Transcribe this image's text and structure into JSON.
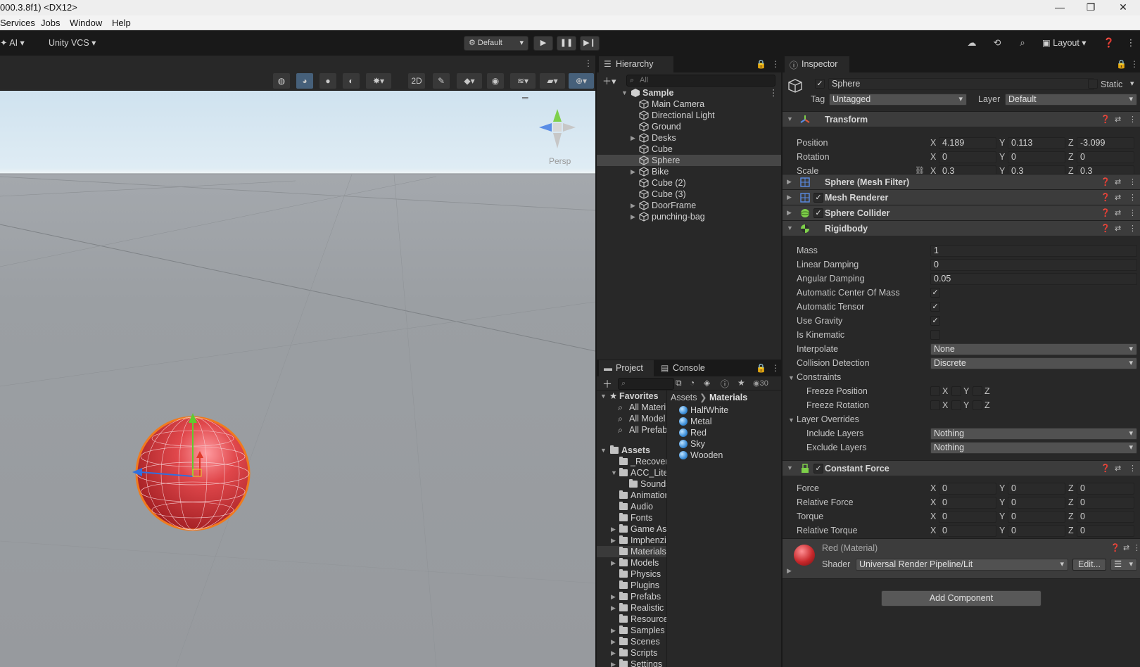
{
  "window": {
    "title": "000.3.8f1) <DX12>",
    "controls": {
      "minimize": "—",
      "maximize": "❐",
      "close": "✕"
    }
  },
  "menu": [
    "Services",
    "Jobs",
    "Window",
    "Help"
  ],
  "toolbar": {
    "ai_label": "AI",
    "vcs_label": "Unity VCS",
    "build_profile": "Default",
    "layout_label": "Layout"
  },
  "scene": {
    "persp_label": "Persp"
  },
  "hierarchy": {
    "tab": "Hierarchy",
    "search_placeholder": "All",
    "scene_name": "Sample",
    "items": [
      {
        "label": "Main Camera",
        "expandable": false
      },
      {
        "label": "Directional Light",
        "expandable": false
      },
      {
        "label": "Ground",
        "expandable": false
      },
      {
        "label": "Desks",
        "expandable": true
      },
      {
        "label": "Cube",
        "expandable": false
      },
      {
        "label": "Sphere",
        "expandable": false,
        "selected": true
      },
      {
        "label": "Bike",
        "expandable": true
      },
      {
        "label": "Cube (2)",
        "expandable": false
      },
      {
        "label": "Cube (3)",
        "expandable": false
      },
      {
        "label": "DoorFrame",
        "expandable": true
      },
      {
        "label": "punching-bag",
        "expandable": true
      }
    ]
  },
  "project": {
    "tabs": [
      "Project",
      "Console"
    ],
    "count_badge": "30",
    "favorites_label": "Favorites",
    "favorites": [
      "All Materi",
      "All Model",
      "All Prefab"
    ],
    "assets_label": "Assets",
    "folders": [
      {
        "label": "_Recover",
        "depth": 1,
        "expandable": false
      },
      {
        "label": "ACC_Lite",
        "depth": 1,
        "expandable": true,
        "open": true
      },
      {
        "label": "Sounds",
        "depth": 2,
        "expandable": false
      },
      {
        "label": "Animation",
        "depth": 1,
        "expandable": false
      },
      {
        "label": "Audio",
        "depth": 1,
        "expandable": false
      },
      {
        "label": "Fonts",
        "depth": 1,
        "expandable": false
      },
      {
        "label": "Game As",
        "depth": 1,
        "expandable": true
      },
      {
        "label": "Imphenzi",
        "depth": 1,
        "expandable": true
      },
      {
        "label": "Materials",
        "depth": 1,
        "expandable": false,
        "selected": true
      },
      {
        "label": "Models",
        "depth": 1,
        "expandable": true
      },
      {
        "label": "Physics",
        "depth": 1,
        "expandable": false
      },
      {
        "label": "Plugins",
        "depth": 1,
        "expandable": false
      },
      {
        "label": "Prefabs",
        "depth": 1,
        "expandable": true
      },
      {
        "label": "Realistic (",
        "depth": 1,
        "expandable": true
      },
      {
        "label": "Resource",
        "depth": 1,
        "expandable": false
      },
      {
        "label": "Samples",
        "depth": 1,
        "expandable": true
      },
      {
        "label": "Scenes",
        "depth": 1,
        "expandable": true
      },
      {
        "label": "Scripts",
        "depth": 1,
        "expandable": true
      },
      {
        "label": "Settings",
        "depth": 1,
        "expandable": true
      }
    ],
    "breadcrumb": [
      "Assets",
      "Materials"
    ],
    "materials": [
      "HalfWhite",
      "Metal",
      "Red",
      "Sky",
      "Wooden"
    ]
  },
  "inspector": {
    "tab": "Inspector",
    "object_name": "Sphere",
    "static_label": "Static",
    "tag_label": "Tag",
    "tag_value": "Untagged",
    "layer_label": "Layer",
    "layer_value": "Default",
    "transform": {
      "title": "Transform",
      "position_label": "Position",
      "position": [
        "4.189",
        "0.113",
        "-3.099"
      ],
      "rotation_label": "Rotation",
      "rotation": [
        "0",
        "0",
        "0"
      ],
      "scale_label": "Scale",
      "scale": [
        "0.3",
        "0.3",
        "0.3"
      ]
    },
    "mesh_filter_title": "Sphere (Mesh Filter)",
    "mesh_renderer_title": "Mesh Renderer",
    "sphere_collider_title": "Sphere Collider",
    "rigidbody": {
      "title": "Rigidbody",
      "mass_label": "Mass",
      "mass": "1",
      "linear_damping_label": "Linear Damping",
      "linear_damping": "0",
      "angular_damping_label": "Angular Damping",
      "angular_damping": "0.05",
      "auto_com_label": "Automatic Center Of Mass",
      "auto_tensor_label": "Automatic Tensor",
      "use_gravity_label": "Use Gravity",
      "is_kinematic_label": "Is Kinematic",
      "interpolate_label": "Interpolate",
      "interpolate": "None",
      "collision_label": "Collision Detection",
      "collision": "Discrete",
      "constraints_label": "Constraints",
      "freeze_pos_label": "Freeze Position",
      "freeze_rot_label": "Freeze Rotation",
      "layer_overrides_label": "Layer Overrides",
      "include_label": "Include Layers",
      "include": "Nothing",
      "exclude_label": "Exclude Layers",
      "exclude": "Nothing"
    },
    "constant_force": {
      "title": "Constant Force",
      "force_label": "Force",
      "force": [
        "0",
        "0",
        "0"
      ],
      "relforce_label": "Relative Force",
      "relforce": [
        "0",
        "0",
        "0"
      ],
      "torque_label": "Torque",
      "torque": [
        "0",
        "0",
        "0"
      ],
      "reltorque_label": "Relative Torque",
      "reltorque": [
        "0",
        "0",
        "0"
      ]
    },
    "material": {
      "title": "Red (Material)",
      "shader_label": "Shader",
      "shader": "Universal Render Pipeline/Lit",
      "edit_label": "Edit..."
    },
    "add_component_label": "Add Component",
    "axis": [
      "X",
      "Y",
      "Z"
    ]
  },
  "colors": {
    "panel_bg": "#282828",
    "header_bg": "#3c3c3c",
    "selection": "#464646",
    "sphere_red": "#c8282b",
    "outline_orange": "#f07a1e"
  }
}
